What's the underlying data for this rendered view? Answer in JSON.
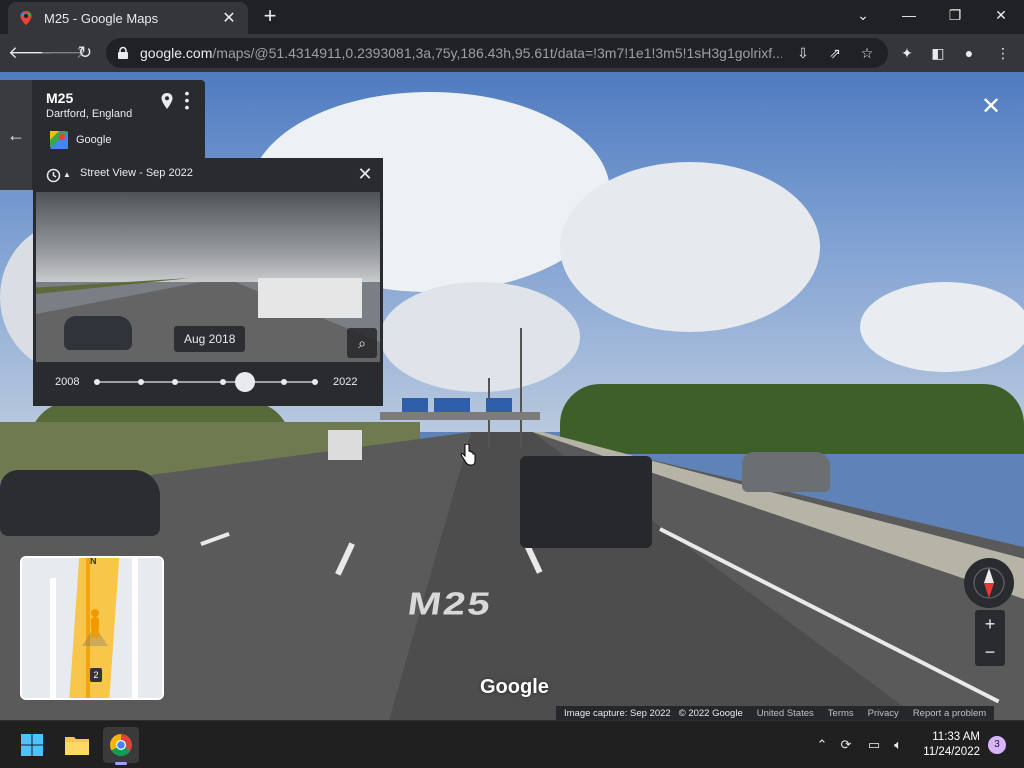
{
  "browser": {
    "tab_title": "M25 - Google Maps",
    "tab_close": "✕",
    "new_tab": "+",
    "url_host": "google.com",
    "url_path": "/maps/@51.4314911,0.2393081,3a,75y,186.43h,95.61t/data=!3m7!1e1!3m5!1sH3g1golrixf...",
    "window_controls": {
      "minimize": "—",
      "restore": "❐",
      "close": "✕",
      "tab_list": "⌄"
    }
  },
  "place_card": {
    "name": "M25",
    "location": "Dartford, England",
    "source": "Google"
  },
  "time_travel": {
    "title": "Street View - Sep 2022",
    "preview_date": "Aug 2018",
    "start_year": "2008",
    "end_year": "2022",
    "selected_position": 0.68,
    "stops": [
      0,
      0.2,
      0.36,
      0.58,
      0.68,
      0.86,
      1.0
    ]
  },
  "street_view": {
    "watermark": "Google",
    "road_marking": "M25",
    "minimap_shield": "2",
    "minimap_north": "N"
  },
  "controls": {
    "zoom_in": "+",
    "zoom_out": "−"
  },
  "attribution": {
    "capture": "Image capture: Sep 2022",
    "copyright": "© 2022 Google",
    "country": "United States",
    "terms": "Terms",
    "privacy": "Privacy",
    "report": "Report a problem"
  },
  "taskbar": {
    "time": "11:33 AM",
    "date": "11/24/2022",
    "notifications": "3"
  },
  "colors": {
    "accent_purple": "#a59dff",
    "maps_yellow": "#f8c648",
    "chrome_dark": "#202124"
  }
}
